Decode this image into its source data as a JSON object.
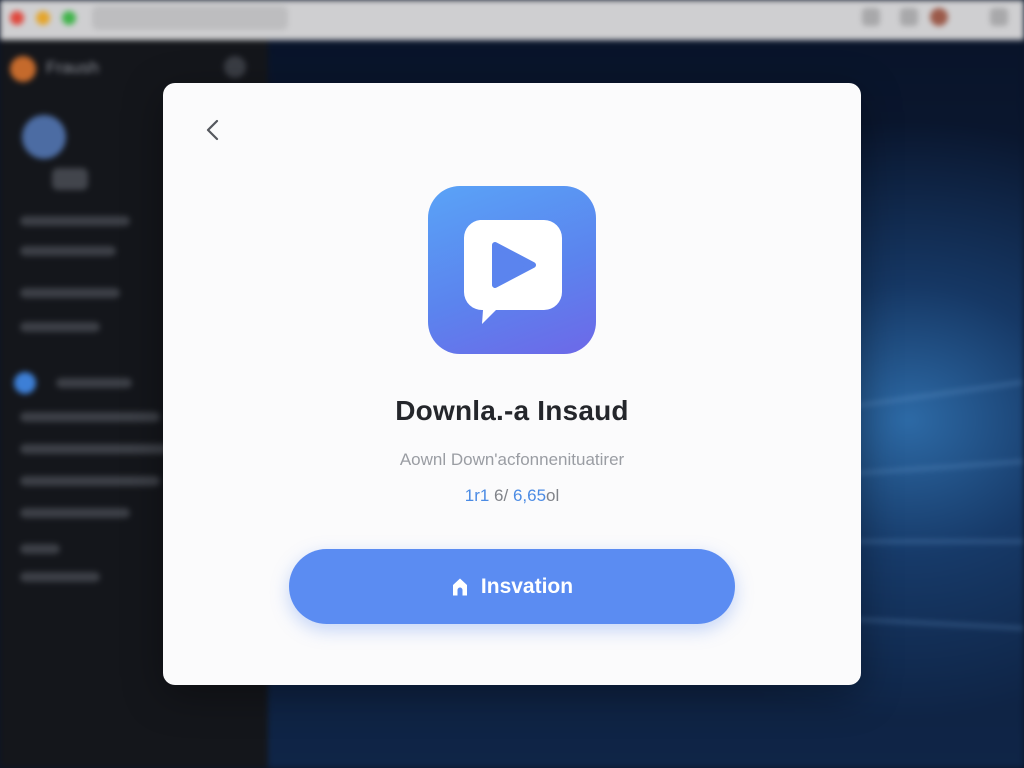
{
  "background": {
    "app_name": "Fraush"
  },
  "dialog": {
    "back_icon": "chevron-left-icon",
    "app_icon": "play-chat-bubble-icon",
    "title": "Downla.-a Insaud",
    "subtitle": "Aownl Down'acfonnenituatirer",
    "meta_part1": "1r1",
    "meta_part2": " 6/ ",
    "meta_part3": "6,65",
    "meta_part4": "ol",
    "install_icon": "home-icon",
    "install_label": "Insvation"
  },
  "colors": {
    "accent": "#5b8cf2",
    "icon_gradient_top": "#5aa3f7",
    "icon_gradient_bottom": "#6d68e8",
    "title_text": "#24262b",
    "dialog_bg": "#fbfbfc"
  }
}
